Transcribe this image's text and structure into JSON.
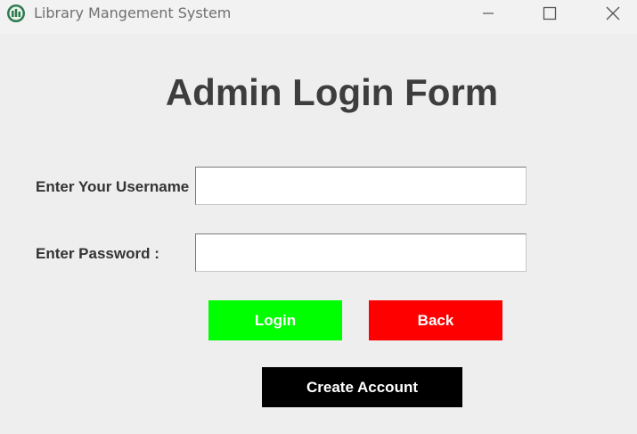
{
  "window": {
    "title": "Library Mangement System",
    "icon": "app-icon",
    "controls": {
      "minimize_icon": "minimize-icon",
      "maximize_icon": "maximize-icon",
      "close_icon": "close-icon"
    }
  },
  "form": {
    "title": "Admin Login Form",
    "username_label": "Enter Your Username :",
    "username_value": "",
    "password_label": "Enter Password :",
    "password_value": ""
  },
  "buttons": {
    "login_label": "Login",
    "back_label": "Back",
    "create_label": "Create Account"
  },
  "colors": {
    "login_bg": "#00ff00",
    "back_bg": "#ff0000",
    "create_bg": "#000000",
    "title_text": "#3d3d3d"
  }
}
